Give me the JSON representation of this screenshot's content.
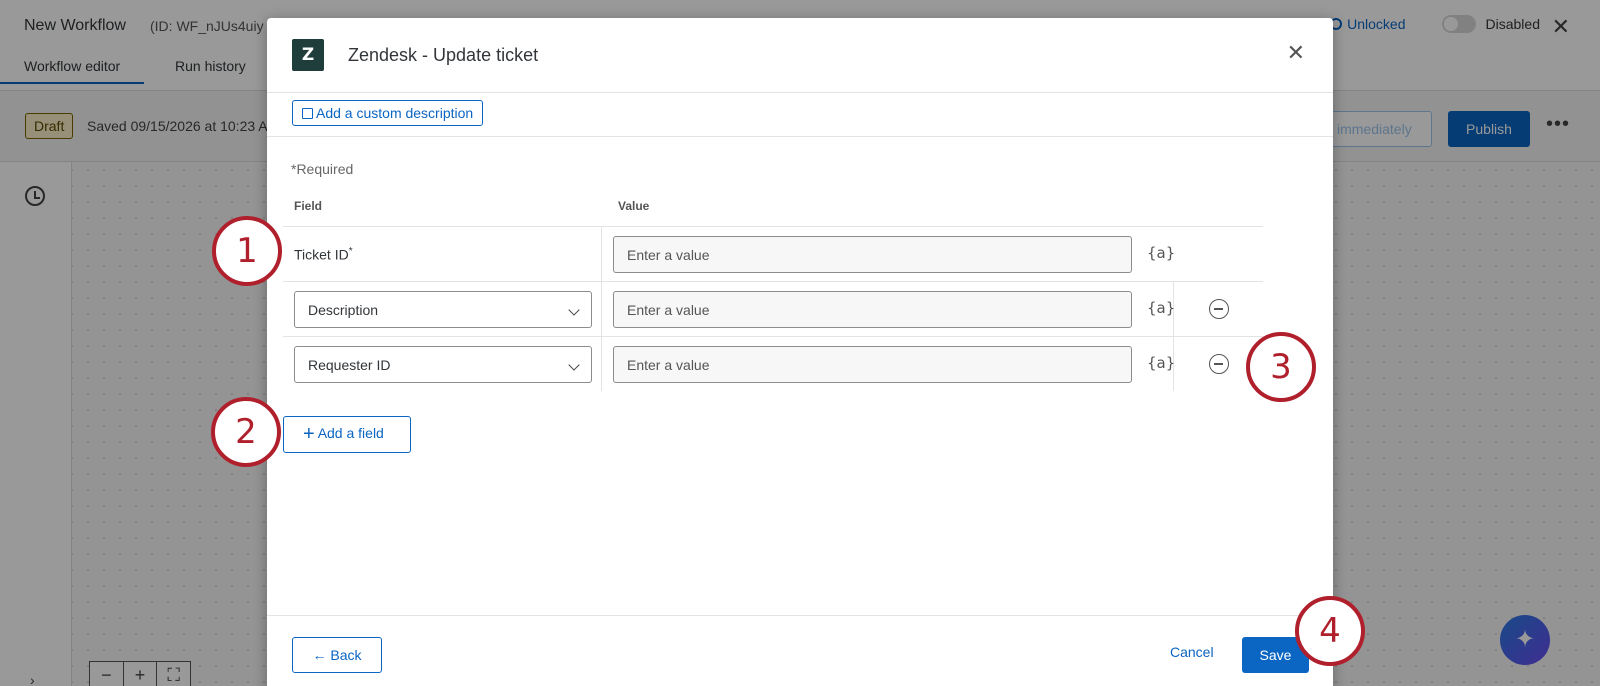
{
  "background": {
    "workflow_title": "New Workflow",
    "workflow_id": "(ID: WF_nJUs4uiy",
    "tabs": [
      {
        "label": "Workflow editor",
        "active": true
      },
      {
        "label": "Run history",
        "active": false
      }
    ],
    "lock_status": "Unlocked",
    "toggle_label": "Disabled",
    "draft_badge": "Draft",
    "saved_text": "Saved 09/15/2026 at 10:23 A",
    "run_button_partial": "immediately",
    "publish_label": "Publish",
    "more_label": "•••",
    "zoom_controls": [
      "−",
      "+",
      "⛶"
    ],
    "collapse_arrow": "›",
    "assistant_icon": "✦"
  },
  "modal": {
    "logo_letter": "Z",
    "title": "Zendesk - Update ticket",
    "close_label": "✕",
    "custom_description_label": "Add a custom description",
    "required_note": "*Required",
    "columns": {
      "field": "Field",
      "value": "Value"
    },
    "rows": [
      {
        "field": "Ticket ID",
        "required_mark": "*",
        "placeholder": "Enter a value",
        "piped_text": "{a}",
        "removable": false,
        "type": "static"
      },
      {
        "field": "Description",
        "placeholder": "Enter a value",
        "piped_text": "{a}",
        "removable": true,
        "type": "select"
      },
      {
        "field": "Requester ID",
        "placeholder": "Enter a value",
        "piped_text": "{a}",
        "removable": true,
        "type": "select"
      }
    ],
    "add_field_label": "Add a field",
    "back_label": "Back",
    "cancel_label": "Cancel",
    "save_label": "Save"
  },
  "markers": [
    "1",
    "2",
    "3",
    "4"
  ],
  "colors": {
    "accent": "#0b65c2",
    "marker": "#b0202c",
    "zendesk_logo": "#1f3d3a",
    "draft_badge_bg": "#fcefc6"
  }
}
